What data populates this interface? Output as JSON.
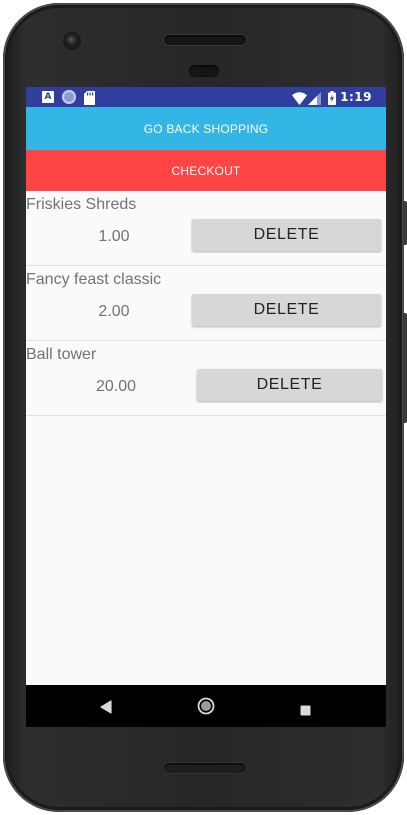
{
  "status_bar": {
    "icons_left": [
      "notification-a-icon",
      "sync-circle-icon",
      "sd-card-icon"
    ],
    "icons_right": [
      "wifi-icon",
      "cell-signal-icon",
      "battery-charging-icon"
    ],
    "notification_a_glyph": "A",
    "time": "1:19"
  },
  "actions": {
    "go_back_label": "GO BACK SHOPPING",
    "checkout_label": "CHECKOUT"
  },
  "cart": {
    "items": [
      {
        "name": "Friskies Shreds",
        "price": "1.00",
        "delete_label": "DELETE"
      },
      {
        "name": "Fancy feast classic",
        "price": "2.00",
        "delete_label": "DELETE"
      },
      {
        "name": "Ball tower",
        "price": "20.00",
        "delete_label": "DELETE"
      }
    ]
  },
  "nav_bar": {
    "icons": [
      "back-triangle-icon",
      "home-circle-icon",
      "recents-square-icon"
    ]
  },
  "colors": {
    "status_bar": "#303f9f",
    "go_back_button": "#33b5e5",
    "checkout_button": "#ff4444",
    "delete_button": "#d6d7d7",
    "screen_background": "#fafafa",
    "item_text": "#737373"
  }
}
